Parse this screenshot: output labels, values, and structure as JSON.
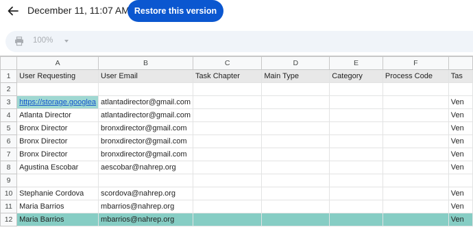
{
  "header": {
    "version_title": "December 11, 11:07 AM",
    "restore_label": "Restore this version",
    "back_icon": "arrow-left-icon"
  },
  "toolbar": {
    "print_icon": "print-icon",
    "zoom": "100%"
  },
  "colors": {
    "accent": "#0b57d0",
    "header_row_bg": "#e8e8e8",
    "highlight_row_bg": "#86cdc4",
    "link": "#1155cc"
  },
  "sheet": {
    "columns": [
      "A",
      "B",
      "C",
      "D",
      "E",
      "F",
      ""
    ],
    "rows": [
      {
        "num": "1",
        "cells": [
          "User Requesting",
          "User Email",
          "Task Chapter",
          "Main Type",
          "Category",
          "Process Code",
          "Tas"
        ]
      },
      {
        "num": "2",
        "cells": [
          "",
          "",
          "",
          "",
          "",
          "",
          ""
        ]
      },
      {
        "num": "3",
        "cells": [
          "https://storage.googlea",
          "atlantadirector@gmail.com",
          "",
          "",
          "",
          "",
          "Ven"
        ]
      },
      {
        "num": "4",
        "cells": [
          "Atlanta Director",
          "atlantadirector@gmail.com",
          "",
          "",
          "",
          "",
          "Ven"
        ]
      },
      {
        "num": "5",
        "cells": [
          "Bronx Director",
          "bronxdirector@gmail.com",
          "",
          "",
          "",
          "",
          "Ven"
        ]
      },
      {
        "num": "6",
        "cells": [
          "Bronx Director",
          "bronxdirector@gmail.com",
          "",
          "",
          "",
          "",
          "Ven"
        ]
      },
      {
        "num": "7",
        "cells": [
          "Bronx Director",
          "bronxdirector@gmail.com",
          "",
          "",
          "",
          "",
          "Ven"
        ]
      },
      {
        "num": "8",
        "cells": [
          "Agustina Escobar",
          "aescobar@nahrep.org",
          "",
          "",
          "",
          "",
          "Ven"
        ]
      },
      {
        "num": "9",
        "cells": [
          "",
          "",
          "",
          "",
          "",
          "",
          ""
        ]
      },
      {
        "num": "10",
        "cells": [
          "Stephanie Cordova",
          "scordova@nahrep.org",
          "",
          "",
          "",
          "",
          "Ven"
        ]
      },
      {
        "num": "11",
        "cells": [
          "Maria Barrios",
          "mbarrios@nahrep.org",
          "",
          "",
          "",
          "",
          "Ven"
        ]
      },
      {
        "num": "12",
        "cells": [
          "Maria Barrios",
          "mbarrios@nahrep.org",
          "",
          "",
          "",
          "",
          "Ven"
        ]
      }
    ]
  }
}
